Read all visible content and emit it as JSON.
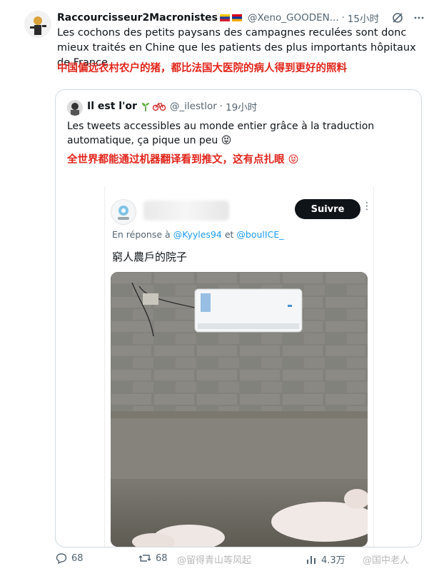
{
  "tweet": {
    "author_name": "Raccourcisseur2Macronistes",
    "handle": "@Xeno_GOODEN...",
    "time": "15小时",
    "text": "Les cochons des petits paysans des campagnes reculées sont donc mieux traités en Chine que les patients des plus importants hôpitaux de France",
    "translation_cn": "中国偏远农村农户的猪，都比法国大医院的病人得到更好的照料"
  },
  "quote": {
    "author_name": "Il est l'or",
    "handle": "@_ilestlor",
    "time": "19小时",
    "text": "Les tweets accessibles au monde entier grâce à la traduction automatique, ça pique un peu 😝",
    "translation_cn": "全世界都能通过机器翻译看到推文，这有点扎眼 😝"
  },
  "embedded": {
    "follow_label": "Suivre",
    "reply_prefix": "En réponse à",
    "reply_user1": "@Kyyles94",
    "reply_and": "et",
    "reply_user2": "@boulICE_",
    "text": "窮人農戶的院子"
  },
  "actions": {
    "replies": "68",
    "retweets": "68",
    "views": "4.3万"
  },
  "watermarks": {
    "wm1": "@留得青山等风起",
    "wm2": "@国中老人"
  },
  "colors": {
    "accent": "#1d9bf0",
    "translation_red": "#e0251b"
  }
}
